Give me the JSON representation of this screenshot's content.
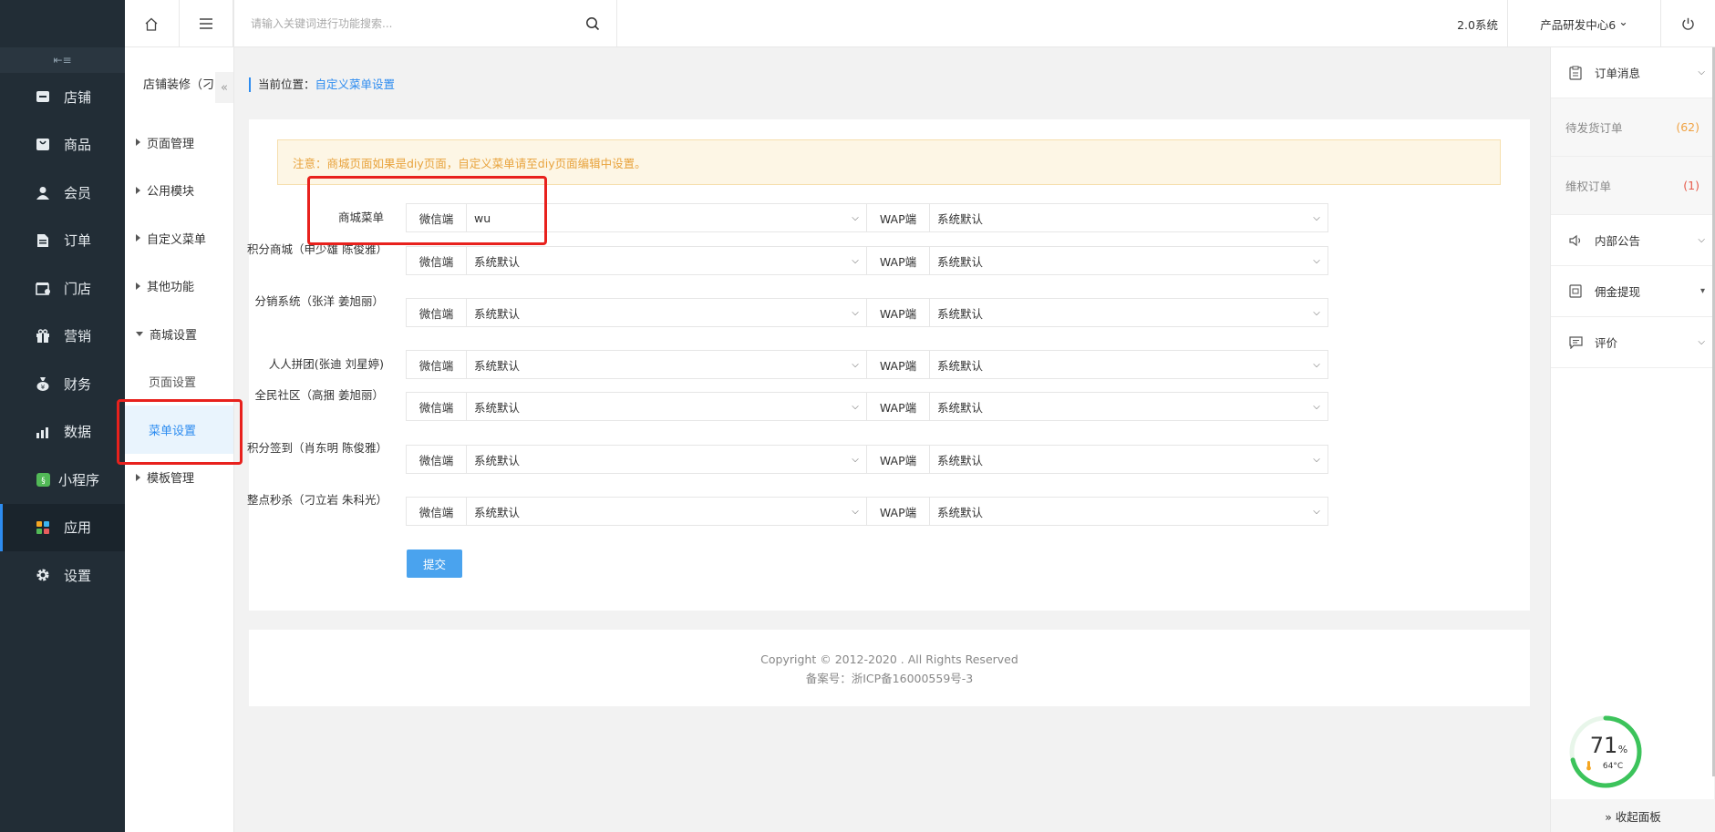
{
  "sidebar": {
    "collapse_glyph": "⇤≡",
    "items": [
      {
        "label": "店铺",
        "icon": "store-icon"
      },
      {
        "label": "商品",
        "icon": "goods-icon"
      },
      {
        "label": "会员",
        "icon": "member-icon"
      },
      {
        "label": "订单",
        "icon": "order-icon"
      },
      {
        "label": "门店",
        "icon": "shop-icon"
      },
      {
        "label": "营销",
        "icon": "gift-icon"
      },
      {
        "label": "财务",
        "icon": "finance-icon"
      },
      {
        "label": "数据",
        "icon": "chart-icon"
      },
      {
        "label": "小程序",
        "icon": "miniapp-icon"
      },
      {
        "label": "应用",
        "icon": "apps-icon",
        "active": true
      },
      {
        "label": "设置",
        "icon": "gear-icon"
      }
    ]
  },
  "subside": {
    "title": "店铺装修（刁",
    "fold_glyph": "«",
    "items": [
      {
        "label": "页面管理"
      },
      {
        "label": "公用模块"
      },
      {
        "label": "自定义菜单"
      },
      {
        "label": "其他功能"
      },
      {
        "label": "商城设置"
      },
      {
        "label": "页面设置"
      },
      {
        "label": "菜单设置"
      },
      {
        "label": "模板管理"
      }
    ]
  },
  "topbar": {
    "search_placeholder": "请输入关键词进行功能搜索...",
    "system": "2.0系统",
    "org": "产品研发中心6",
    "org_caret": "⌄"
  },
  "breadcrumb": {
    "prefix": "当前位置：",
    "current": "自定义菜单设置"
  },
  "notice": "注意：商城页面如果是diy页面，自定义菜单请至diy页面编辑中设置。",
  "prefix_wx": "微信端",
  "prefix_wap": "WAP端",
  "menu_rows": [
    {
      "label": "商城菜单",
      "wx": "wu",
      "wap": "系统默认"
    },
    {
      "label": "积分商城（申少雄 陈俊雅）",
      "wx": "系统默认",
      "wap": "系统默认"
    },
    {
      "label": "分销系统（张洋 姜旭丽）",
      "wx": "系统默认",
      "wap": "系统默认"
    },
    {
      "label": "人人拼团(张迪 刘星婷)",
      "wx": "系统默认",
      "wap": "系统默认"
    },
    {
      "label": "全民社区（高捆 姜旭丽）",
      "wx": "系统默认",
      "wap": "系统默认"
    },
    {
      "label": "积分签到（肖东明 陈俊雅）",
      "wx": "系统默认",
      "wap": "系统默认"
    },
    {
      "label": "整点秒杀（刁立岩 朱科光）",
      "wx": "系统默认",
      "wap": "系统默认"
    }
  ],
  "submit_label": "提交",
  "footer": {
    "copyright": "Copyright © 2012-2020 . All Rights Reserved",
    "icp": "备案号：浙ICP备16000559号-3"
  },
  "rpanel": {
    "order_msg": "订单消息",
    "pending": {
      "label": "待发货订单",
      "count": "(62)"
    },
    "rights": {
      "label": "维权订单",
      "count": "(1)"
    },
    "notice": "内部公告",
    "commission": "佣金提现",
    "review": "评价",
    "gauge_value": "71",
    "gauge_unit": "%",
    "gauge_percent": 71,
    "temp": "64°C",
    "collapse_label": "» 收起面板"
  },
  "colors": {
    "accent": "#2d8cf0",
    "sidebar_bg": "#222d36",
    "warning": "#e8a33d",
    "highlight": "#e8211d",
    "gauge": "#3cc35b"
  }
}
